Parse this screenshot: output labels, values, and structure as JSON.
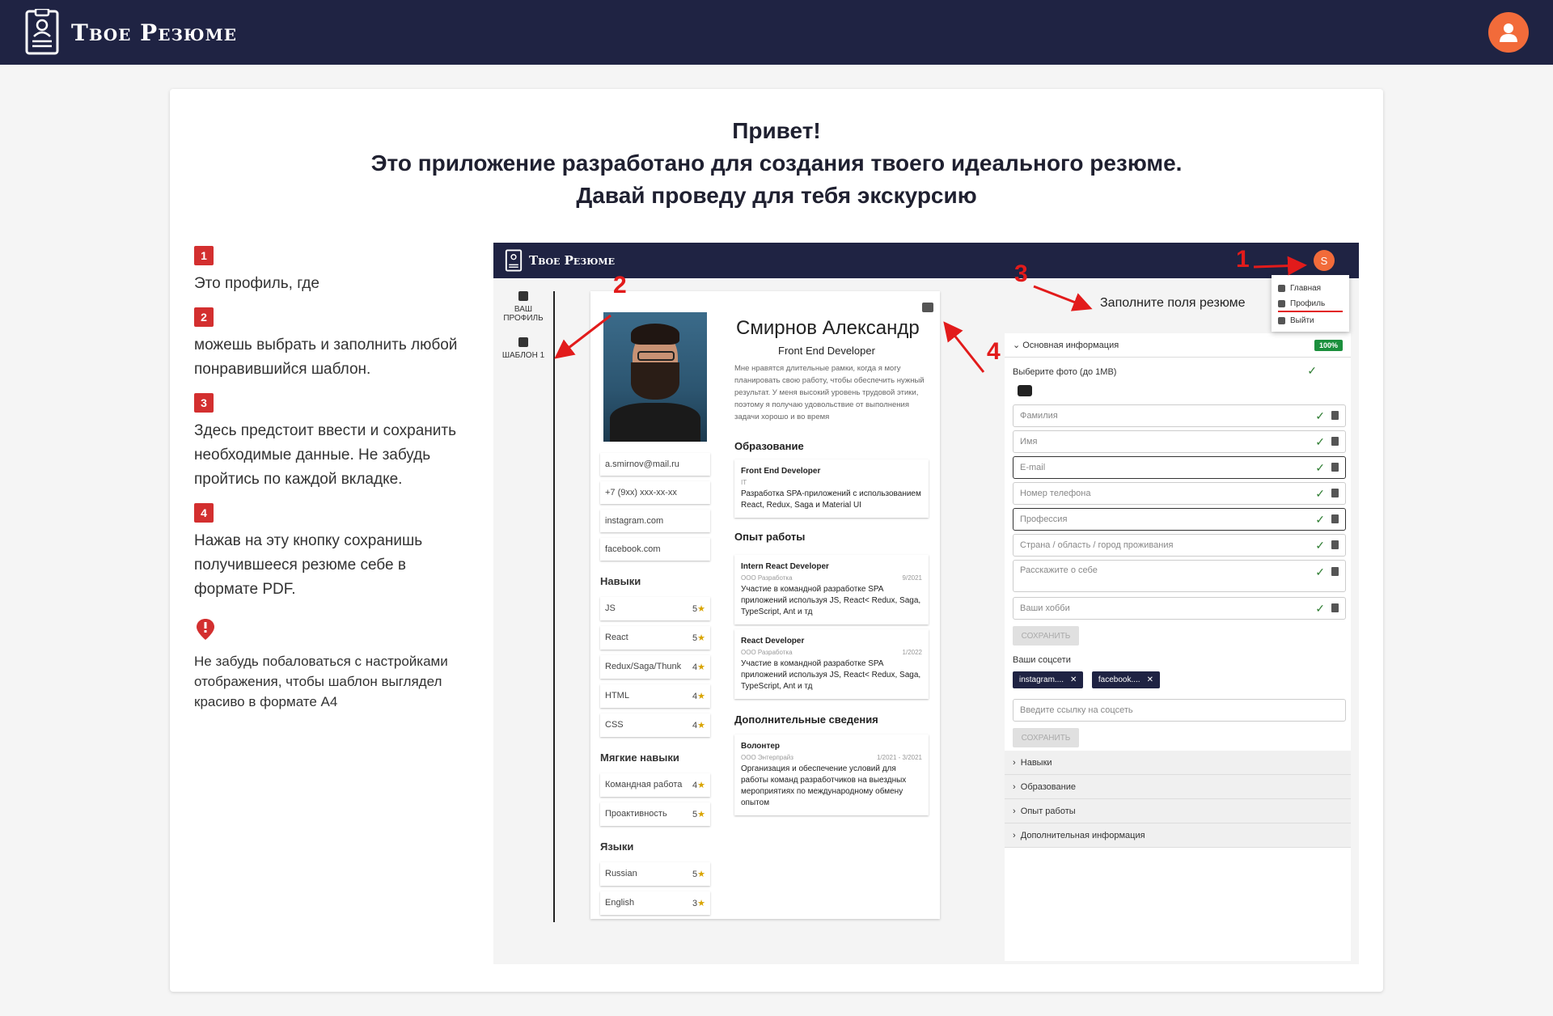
{
  "app": {
    "title": "Твое Резюме"
  },
  "greeting": {
    "line1": "Привет!",
    "line2": "Это приложение разработано для создания твоего идеального резюме.",
    "line3": "Давай проведу для тебя экскурсию"
  },
  "steps": [
    {
      "num": "1",
      "text": "Это профиль, где"
    },
    {
      "num": "2",
      "text": "можешь выбрать и заполнить любой понравившийся шаблон."
    },
    {
      "num": "3",
      "text": "Здесь предстоит ввести и сохранить необходимые данные. Не забудь пройтись по каждой вкладке."
    },
    {
      "num": "4",
      "text": "Нажав на эту кнопку сохранишь получившееся резюме себе в формате PDF."
    }
  ],
  "note": {
    "text": "Не забудь побаловаться с настройками отображения, чтобы шаблон выглядел красиво в формате А4"
  },
  "shot": {
    "title": "Твое Резюме",
    "avatar_letter": "S",
    "sidebar": [
      {
        "label": "ВАШ ПРОФИЛЬ"
      },
      {
        "label": "ШАБЛОН 1"
      }
    ],
    "menu": [
      "Главная",
      "Профиль",
      "Выйти"
    ],
    "fill_hint": "Заполните поля резюме",
    "annotations": [
      "1",
      "2",
      "3",
      "4"
    ],
    "resume": {
      "name": "Смирнов Александр",
      "position": "Front End Developer",
      "bio": "Мне нравятся длительные рамки, когда я могу планировать свою работу, чтобы обеспечить нужный результат. У меня высокий уровень трудовой этики, поэтому я получаю удовольствие от выполнения задачи хорошо и во время",
      "contacts": [
        "a.smirnov@mail.ru",
        "+7 (9xx) xxx-xx-xx",
        "instagram.com",
        "facebook.com"
      ],
      "skills_title": "Навыки",
      "skills": [
        {
          "n": "JS",
          "v": "5"
        },
        {
          "n": "React",
          "v": "5"
        },
        {
          "n": "Redux/Saga/Thunk",
          "v": "4"
        },
        {
          "n": "HTML",
          "v": "4"
        },
        {
          "n": "CSS",
          "v": "4"
        }
      ],
      "soft_title": "Мягкие навыки",
      "soft": [
        {
          "n": "Командная работа",
          "v": "4"
        },
        {
          "n": "Проактивность",
          "v": "5"
        }
      ],
      "lang_title": "Языки",
      "langs": [
        {
          "n": "Russian",
          "v": "5"
        },
        {
          "n": "English",
          "v": "3"
        }
      ],
      "edu_title": "Образование",
      "edu": {
        "title": "Front End Developer",
        "sub": "IT",
        "desc": "Разработка SPA-приложений с использованием React, Redux, Saga и Material UI"
      },
      "work_title": "Опыт работы",
      "work": [
        {
          "title": "Intern React Developer",
          "org": "ООО Разработка",
          "date": "9/2021",
          "desc": "Участие в командной разработке SPA приложений используя JS, React< Redux, Saga, TypeScript, Ant и тд"
        },
        {
          "title": "React Developer",
          "org": "ООО Разработка",
          "date": "1/2022",
          "desc": "Участие в командной разработке SPA приложений используя JS, React< Redux, Saga, TypeScript, Ant и тд"
        }
      ],
      "extra_title": "Дополнительные сведения",
      "extra": {
        "title": "Волонтер",
        "org": "ООО Энтерпрайз",
        "date": "1/2021 - 3/2021",
        "desc": "Организация и обеспечение условий для работы команд разработчиков на выездных мероприятиях по международному обмену опытом"
      }
    },
    "form": {
      "section": "Основная информация",
      "percent": "100%",
      "photo_label": "Выберите фото (до 1MB)",
      "fields": [
        "Фамилия",
        "Имя",
        "E-mail",
        "Номер телефона",
        "Профессия",
        "Страна / область / город проживания",
        "Расскажите о себе",
        "Ваши хобби"
      ],
      "save": "СОХРАНИТЬ",
      "social_title": "Ваши соцсети",
      "chips": [
        "instagram....",
        "facebook...."
      ],
      "social_placeholder": "Введите ссылку на соцсеть",
      "sections": [
        "Навыки",
        "Образование",
        "Опыт работы",
        "Дополнительная информация"
      ]
    }
  }
}
